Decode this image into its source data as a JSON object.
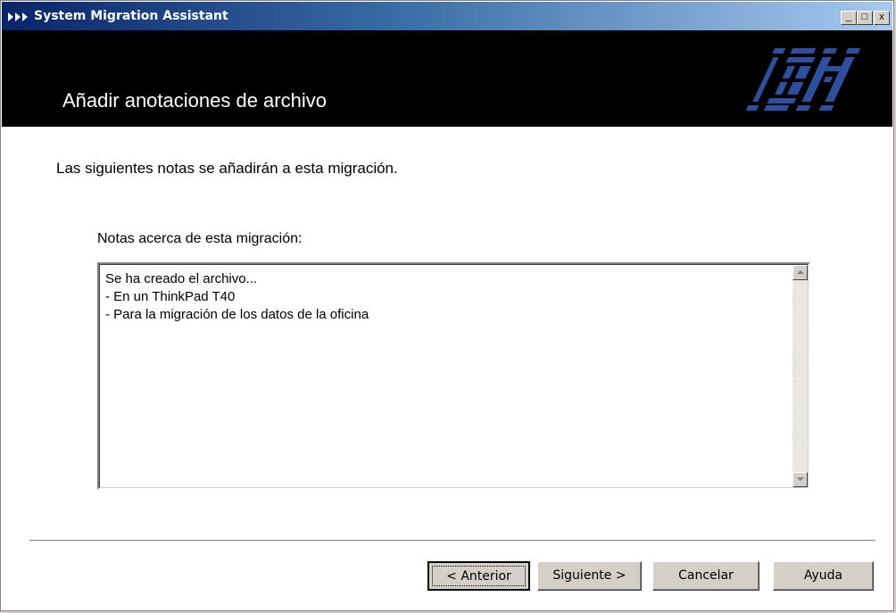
{
  "window": {
    "title": "System Migration Assistant",
    "controls": {
      "minimize": "_",
      "maximize": "□",
      "close": "x"
    }
  },
  "banner": {
    "title": "Añadir anotaciones de archivo",
    "logo": "IBM"
  },
  "content": {
    "intro": "Las siguientes notas se añadirán a esta migración.",
    "notes_label": "Notas acerca de esta migración:",
    "notes_text": "Se ha creado el archivo...\n- En un ThinkPad T40\n- Para la migración de los datos de la oficina"
  },
  "buttons": {
    "back": "< Anterior",
    "next": "Siguiente >",
    "cancel": "Cancelar",
    "help": "Ayuda"
  },
  "colors": {
    "title_gradient_start": "#0a246a",
    "title_gradient_end": "#a6caf0",
    "banner": "#000000",
    "dialog_face": "#d4d0c8",
    "logo": "#2e4f9e"
  },
  "icons": {
    "title": "triple-arrow-icon",
    "scroll_up": "scroll-up-arrow-icon",
    "scroll_down": "scroll-down-arrow-icon"
  }
}
